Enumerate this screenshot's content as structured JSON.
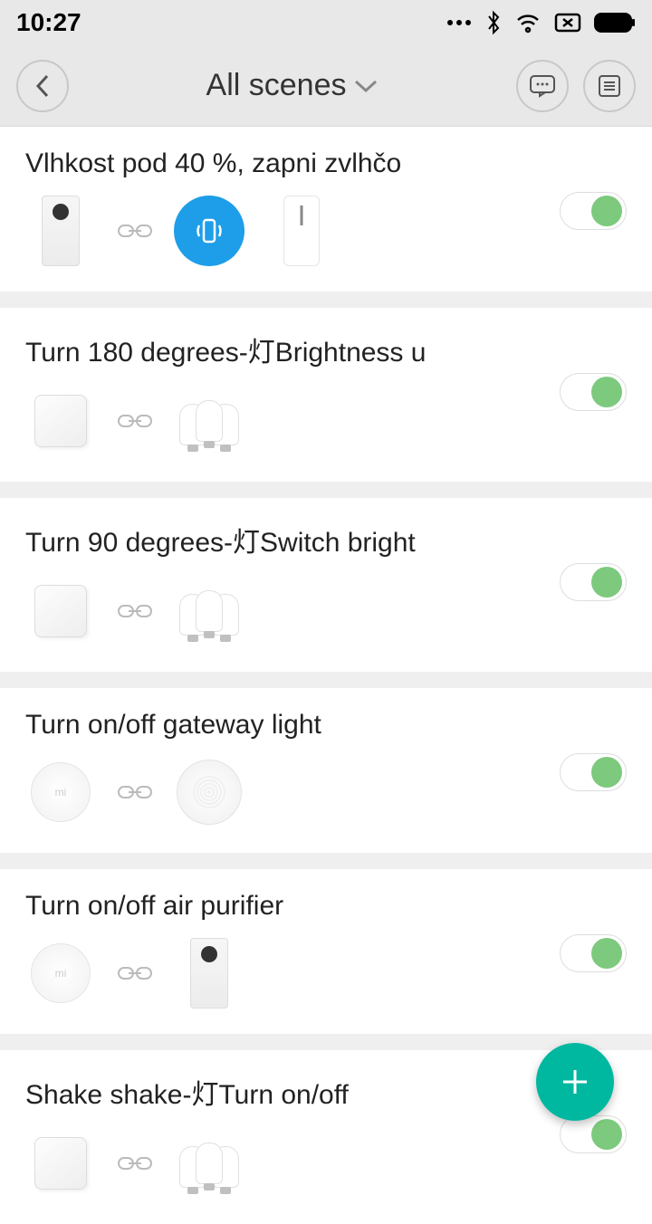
{
  "status": {
    "time": "10:27"
  },
  "header": {
    "title": "All scenes"
  },
  "scenes": [
    {
      "title": "Vlhkost pod 40 %, zapni zvlhčo",
      "trigger": "purifier",
      "actions": [
        "phone-vibrate",
        "humidifier"
      ],
      "enabled": true
    },
    {
      "title": "Turn 180 degrees-灯Brightness u",
      "trigger": "cube",
      "actions": [
        "bulbs"
      ],
      "enabled": true
    },
    {
      "title": "Turn 90 degrees-灯Switch bright",
      "trigger": "cube",
      "actions": [
        "bulbs"
      ],
      "enabled": true
    },
    {
      "title": "Turn on/off gateway light",
      "trigger": "round-button",
      "actions": [
        "gateway"
      ],
      "enabled": true
    },
    {
      "title": "Turn on/off air purifier",
      "trigger": "round-button",
      "actions": [
        "purifier"
      ],
      "enabled": true
    },
    {
      "title": "Shake shake-灯Turn on/off",
      "trigger": "cube",
      "actions": [
        "bulbs"
      ],
      "enabled": true
    }
  ]
}
